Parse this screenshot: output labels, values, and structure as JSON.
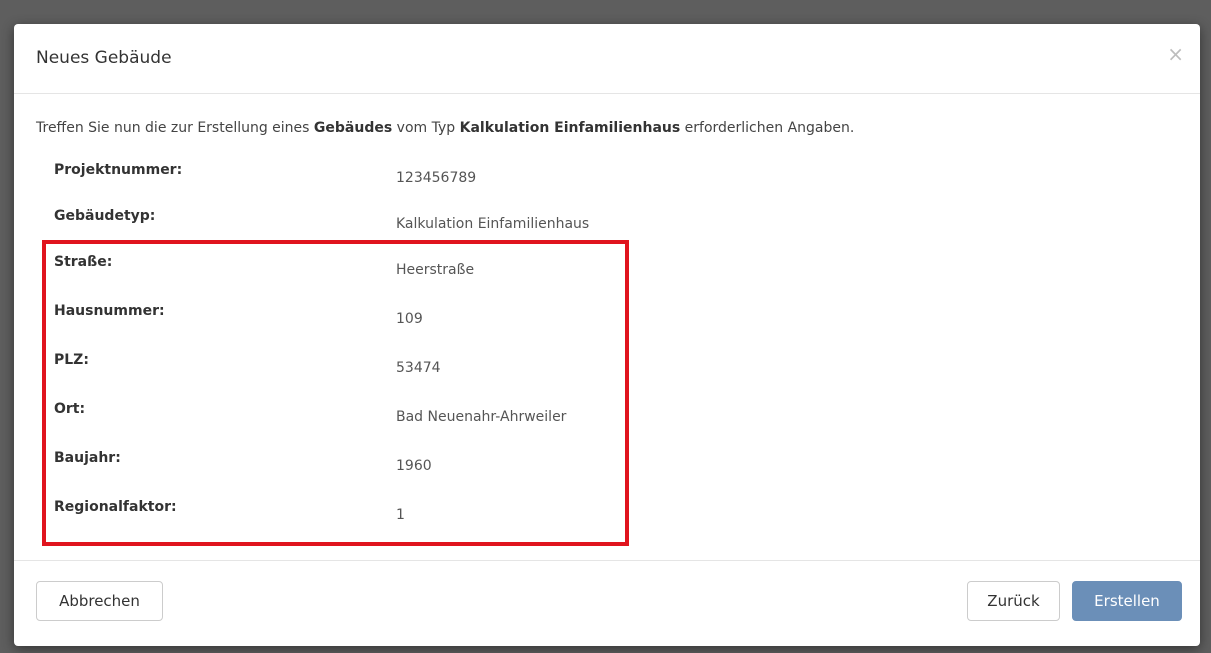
{
  "dialog": {
    "title": "Neues Gebäude",
    "close_symbol": "×",
    "intro": {
      "part1": "Treffen Sie nun die zur Erstellung eines ",
      "bold1": "Gebäudes",
      "part2": " vom Typ ",
      "bold2": "Kalkulation Einfamilienhaus",
      "part3": " erforderlichen Angaben."
    },
    "fields": [
      {
        "label": "Projektnummer:",
        "value": "123456789"
      },
      {
        "label": "Gebäudetyp:",
        "value": "Kalkulation Einfamilienhaus"
      },
      {
        "label": "Straße:",
        "value": "Heerstraße"
      },
      {
        "label": "Hausnummer:",
        "value": "109"
      },
      {
        "label": "PLZ:",
        "value": "53474"
      },
      {
        "label": "Ort:",
        "value": "Bad Neuenahr-Ahrweiler"
      },
      {
        "label": "Baujahr:",
        "value": "1960"
      },
      {
        "label": "Regionalfaktor:",
        "value": "1"
      }
    ],
    "buttons": {
      "cancel": "Abbrechen",
      "back": "Zurück",
      "create": "Erstellen"
    }
  },
  "colors": {
    "highlight": "#e0141e",
    "primary": "#6b8fb8"
  }
}
